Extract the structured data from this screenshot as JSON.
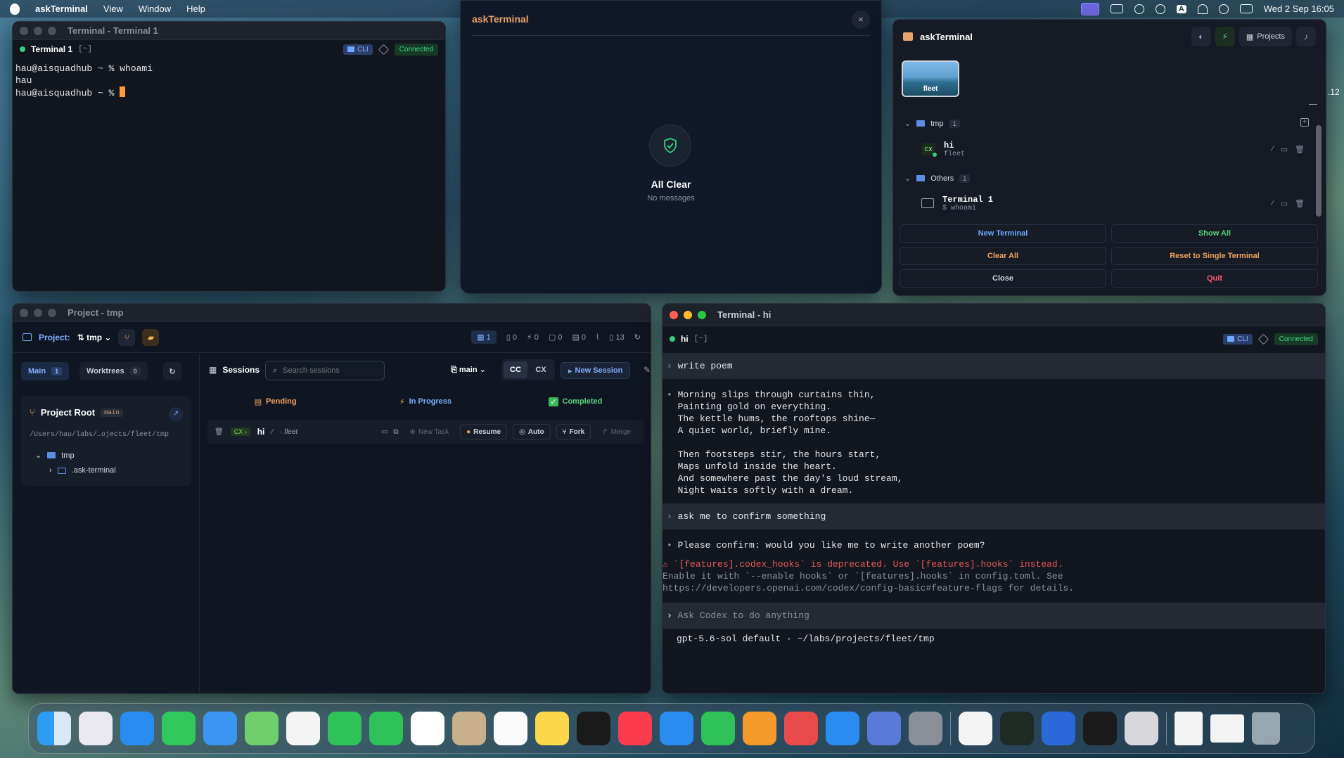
{
  "menubar": {
    "app": "askTerminal",
    "menus": [
      "View",
      "Window",
      "Help"
    ],
    "datetime": "Wed 2 Sep  16:05",
    "input_letter": "A"
  },
  "term1": {
    "title": "Terminal - Terminal 1",
    "name": "Terminal 1",
    "path": "[~]",
    "cli": "CLI",
    "status": "Connected",
    "lines": [
      "hau@aisquadhub ~ % whoami",
      "hau",
      "hau@aisquadhub ~ % "
    ]
  },
  "notif": {
    "title": "askTerminal",
    "close": "×",
    "heading": "All Clear",
    "sub": "No messages"
  },
  "panel": {
    "title": "askTerminal",
    "projects": "Projects",
    "thumb_label": "fleet",
    "side_number": ".12",
    "groups": [
      {
        "name": "tmp",
        "count": "1",
        "item": {
          "name": "hi",
          "sub": "fleet"
        }
      },
      {
        "name": "Others",
        "count": "1",
        "item": {
          "name": "Terminal 1",
          "sub": "$ whoami"
        }
      }
    ],
    "buttons": {
      "new_terminal": "New Terminal",
      "show_all": "Show All",
      "clear_all": "Clear All",
      "reset": "Reset to Single Terminal",
      "close": "Close",
      "quit": "Quit"
    },
    "colors": {
      "blue": "#6ea8ff",
      "green": "#5bd27a",
      "orange": "#f0a35e",
      "red": "#ff5a6e"
    }
  },
  "project": {
    "title": "Project - tmp",
    "label": "Project:",
    "selected": "tmp",
    "stats": [
      "1",
      "0",
      "0",
      "0",
      "0",
      "13"
    ],
    "main_tab": "Main",
    "main_count": "1",
    "worktrees": "Worktrees",
    "worktrees_count": "0",
    "root_title": "Project Root",
    "root_branch": "main",
    "root_path": "/Users/hau/labs/…ojects/fleet/tmp",
    "tree": [
      "tmp",
      ".ask-terminal"
    ],
    "sessions_label": "Sessions",
    "search_placeholder": "Search sessions",
    "branch": "main",
    "cc": "CC",
    "cx": "CX",
    "new_session": "New Session",
    "tabs": {
      "pending": "Pending",
      "in_progress": "In Progress",
      "completed": "Completed"
    },
    "session": {
      "badge": "CX",
      "name": "hi",
      "sub": "fleet",
      "new_task": "New Task",
      "resume": "Resume",
      "auto": "Auto",
      "fork": "Fork",
      "merge": "Merge"
    }
  },
  "termhi": {
    "title": "Terminal - hi",
    "name": "hi",
    "path": "[~]",
    "cli": "CLI",
    "status": "Connected",
    "prompt1": "write poem",
    "poem": "Morning slips through curtains thin,\nPainting gold on everything.\nThe kettle hums, the rooftops shine—\nA quiet world, briefly mine.\n\nThen footsteps stir, the hours start,\nMaps unfold inside the heart.\nAnd somewhere past the day's loud stream,\nNight waits softly with a dream.",
    "prompt2": "ask me to confirm something",
    "answer": "Please confirm: would you like me to write another poem?",
    "warn1": "⚠ `[features].codex_hooks` is deprecated. Use `[features].hooks` instead.",
    "warn2": "Enable it with `--enable hooks` or `[features].hooks` in config.toml. See",
    "warn3": "https://developers.openai.com/codex/config-basic#feature-flags for details.",
    "input_placeholder": "Ask Codex to do anything",
    "footer": "gpt-5.6-sol default · ~/labs/projects/fleet/tmp"
  }
}
